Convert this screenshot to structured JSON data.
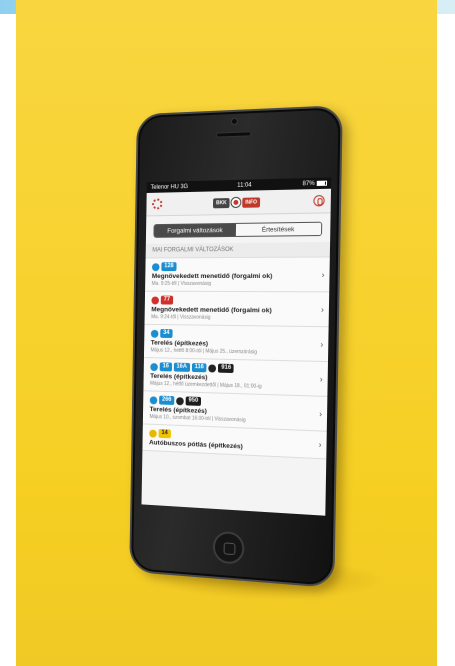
{
  "status_bar": {
    "carrier": "Telenor HU",
    "network": "3G",
    "time": "11:04",
    "battery": "87%"
  },
  "header": {
    "logo_left": "BKK",
    "logo_right": "INFO",
    "settings_icon": "gear-icon",
    "profile_icon": "person-icon"
  },
  "tabs": [
    {
      "label": "Forgalmi változások",
      "active": true
    },
    {
      "label": "Értesítések",
      "active": false
    }
  ],
  "section_title": "MAI FORGALMI VÁLTOZÁSOK",
  "items": [
    {
      "routes": [
        {
          "mode": "bus",
          "label": "128",
          "color": "blue"
        }
      ],
      "title": "Megnövekedett menetidő (forgalmi ok)",
      "subtitle": "Ma. 9:25-től | Visszavonásig"
    },
    {
      "routes": [
        {
          "mode": "trolley",
          "label": "77",
          "color": "red"
        }
      ],
      "title": "Megnövekedett menetidő (forgalmi ok)",
      "subtitle": "Ma. 9:24-től | Visszavonásig"
    },
    {
      "routes": [
        {
          "mode": "bus",
          "label": "34",
          "color": "blue"
        }
      ],
      "title": "Terelés (építkezés)",
      "subtitle": "Május 12., hétfő 8:00-tól | Május 25., üzemzárásig"
    },
    {
      "routes": [
        {
          "mode": "bus",
          "label": "16",
          "color": "blue"
        },
        {
          "mode": "",
          "label": "16A",
          "color": "blue"
        },
        {
          "mode": "",
          "label": "116",
          "color": "blue"
        },
        {
          "mode": "night",
          "label": "916",
          "color": "black"
        }
      ],
      "title": "Terelés (építkezés)",
      "subtitle": "Május 12., hétfő üzemkezdettől | Május 18., 01:00-ig"
    },
    {
      "routes": [
        {
          "mode": "bus",
          "label": "266",
          "color": "blue"
        },
        {
          "mode": "night",
          "label": "950",
          "color": "black"
        }
      ],
      "title": "Terelés (építkezés)",
      "subtitle": "Május 10., szombat 16:00-tól | Visszavonásig"
    },
    {
      "routes": [
        {
          "mode": "tram",
          "label": "14",
          "color": "yellow"
        }
      ],
      "title": "Autóbuszos pótlás (építkezés)",
      "subtitle": ""
    }
  ]
}
